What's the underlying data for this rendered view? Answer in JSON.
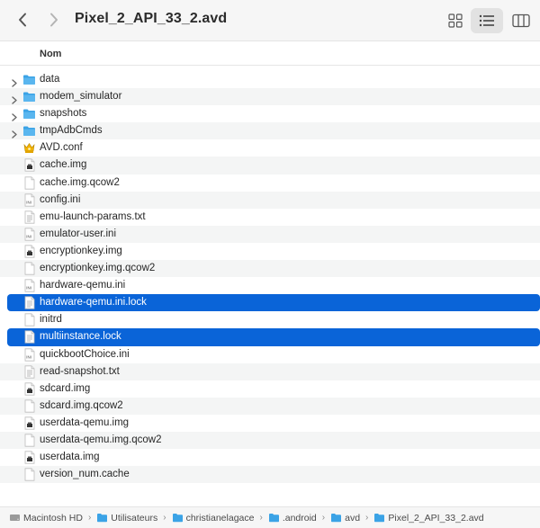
{
  "window": {
    "title": "Pixel_2_API_33_2.avd"
  },
  "toolbar": {
    "back_icon": "chevron-left-icon",
    "forward_icon": "chevron-right-icon",
    "views": [
      "icon-view",
      "list-view",
      "column-view"
    ],
    "active_view": "list-view"
  },
  "list": {
    "column_header": "Nom",
    "items": [
      {
        "name": "data",
        "type": "folder",
        "expandable": true
      },
      {
        "name": "modem_simulator",
        "type": "folder",
        "expandable": true
      },
      {
        "name": "snapshots",
        "type": "folder",
        "expandable": true
      },
      {
        "name": "tmpAdbCmds",
        "type": "folder",
        "expandable": true
      },
      {
        "name": "AVD.conf",
        "type": "conf"
      },
      {
        "name": "cache.img",
        "type": "exec"
      },
      {
        "name": "cache.img.qcow2",
        "type": "doc"
      },
      {
        "name": "config.ini",
        "type": "ini"
      },
      {
        "name": "emu-launch-params.txt",
        "type": "txt"
      },
      {
        "name": "emulator-user.ini",
        "type": "ini"
      },
      {
        "name": "encryptionkey.img",
        "type": "exec"
      },
      {
        "name": "encryptionkey.img.qcow2",
        "type": "doc"
      },
      {
        "name": "hardware-qemu.ini",
        "type": "ini"
      },
      {
        "name": "hardware-qemu.ini.lock",
        "type": "txt",
        "selected": true
      },
      {
        "name": "initrd",
        "type": "doc"
      },
      {
        "name": "multiinstance.lock",
        "type": "txt",
        "selected": true
      },
      {
        "name": "quickbootChoice.ini",
        "type": "ini"
      },
      {
        "name": "read-snapshot.txt",
        "type": "txt"
      },
      {
        "name": "sdcard.img",
        "type": "exec"
      },
      {
        "name": "sdcard.img.qcow2",
        "type": "doc"
      },
      {
        "name": "userdata-qemu.img",
        "type": "exec"
      },
      {
        "name": "userdata-qemu.img.qcow2",
        "type": "doc"
      },
      {
        "name": "userdata.img",
        "type": "exec"
      },
      {
        "name": "version_num.cache",
        "type": "doc"
      }
    ]
  },
  "pathbar": {
    "crumbs": [
      {
        "label": "Macintosh HD",
        "icon": "hard-drive-icon"
      },
      {
        "label": "Utilisateurs",
        "icon": "folder-icon"
      },
      {
        "label": "christianelagace",
        "icon": "home-folder-icon"
      },
      {
        "label": ".android",
        "icon": "folder-icon"
      },
      {
        "label": "avd",
        "icon": "folder-icon"
      },
      {
        "label": "Pixel_2_API_33_2.avd",
        "icon": "folder-icon"
      }
    ],
    "separator": "›"
  },
  "colors": {
    "selection": "#0a64d8",
    "folder": "#3ba3e6",
    "alt_row": "#f4f5f5"
  }
}
